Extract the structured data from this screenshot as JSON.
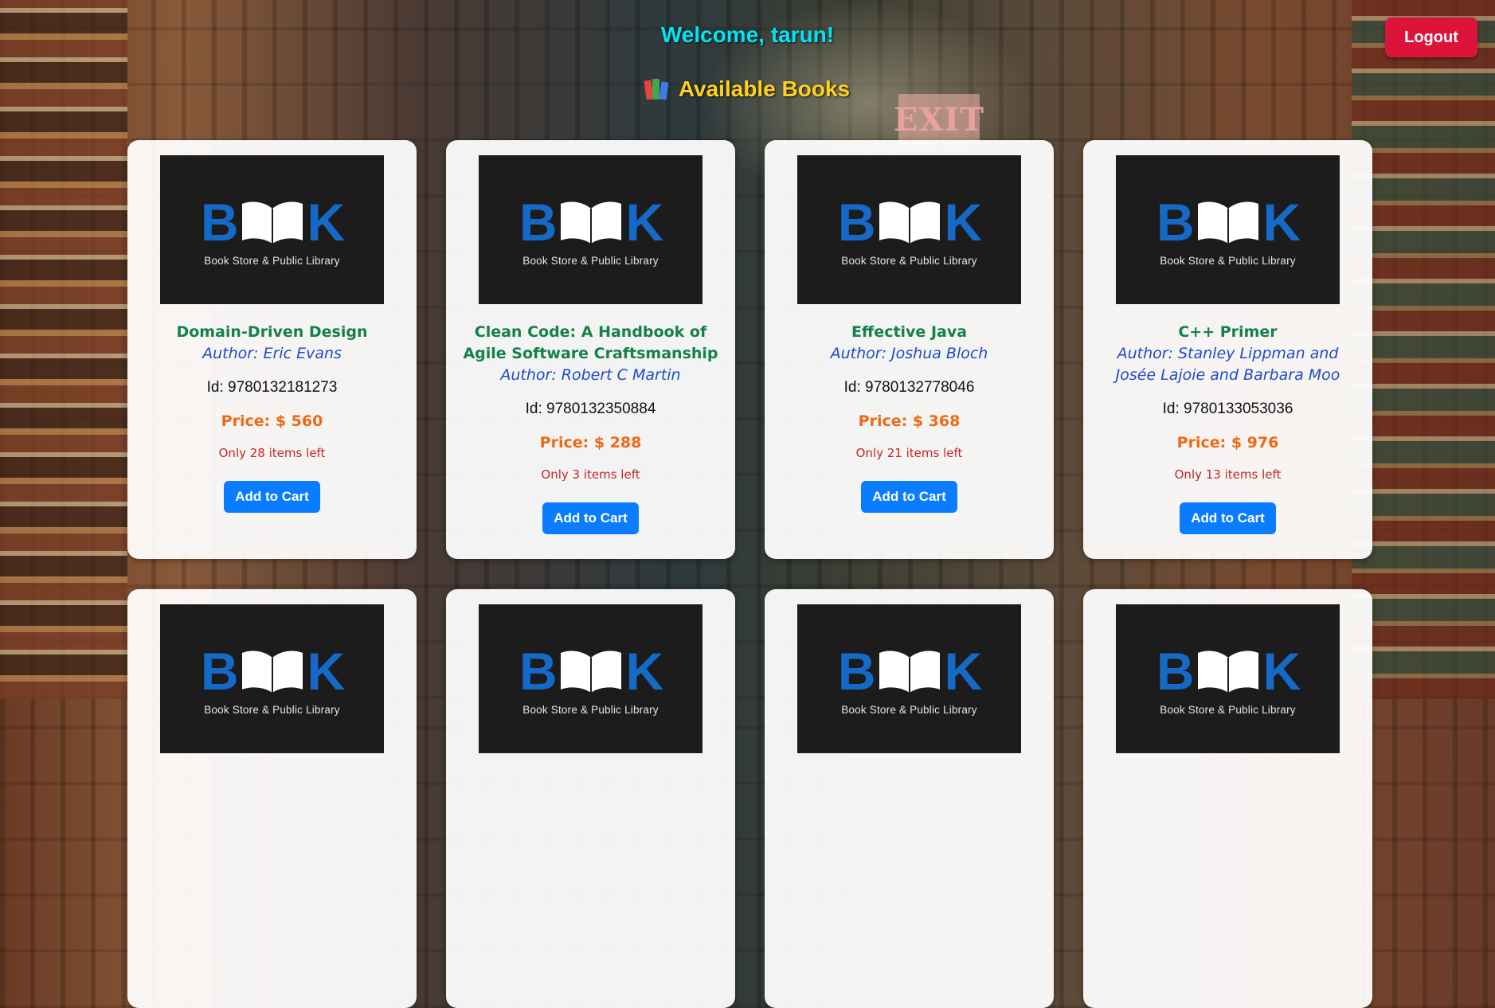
{
  "header": {
    "welcome": "Welcome, tarun!",
    "heading": "Available Books",
    "heading_icon": "books-icon",
    "logout_label": "Logout"
  },
  "background": {
    "exit_sign": "EXIT"
  },
  "cover": {
    "logo_b": "B",
    "logo_k": "K",
    "tagline": "Book Store & Public Library"
  },
  "books": [
    {
      "title": "Domain-Driven Design",
      "author": "Author: Eric Evans",
      "id": "Id: 9780132181273",
      "price": "Price: $ 560",
      "stock": "Only 28 items left",
      "cart_label": "Add to Cart"
    },
    {
      "title": "Clean Code: A Handbook of Agile Software Craftsmanship",
      "author": "Author: Robert C Martin",
      "id": "Id: 9780132350884",
      "price": "Price: $ 288",
      "stock": "Only 3 items left",
      "cart_label": "Add to Cart"
    },
    {
      "title": "Effective Java",
      "author": "Author: Joshua Bloch",
      "id": "Id: 9780132778046",
      "price": "Price: $ 368",
      "stock": "Only 21 items left",
      "cart_label": "Add to Cart"
    },
    {
      "title": "C++ Primer",
      "author": "Author: Stanley Lippman and Josée Lajoie and Barbara Moo",
      "id": "Id: 9780133053036",
      "price": "Price: $ 976",
      "stock": "Only 13 items left",
      "cart_label": "Add to Cart"
    }
  ],
  "colors": {
    "welcome": "#00e5f5",
    "heading": "#ffd21a",
    "logout": "#dc143c",
    "title": "#14804a",
    "author": "#1e4bc8",
    "price": "#ee6a14",
    "stock": "#c0282a",
    "cart": "#0a7cff"
  }
}
